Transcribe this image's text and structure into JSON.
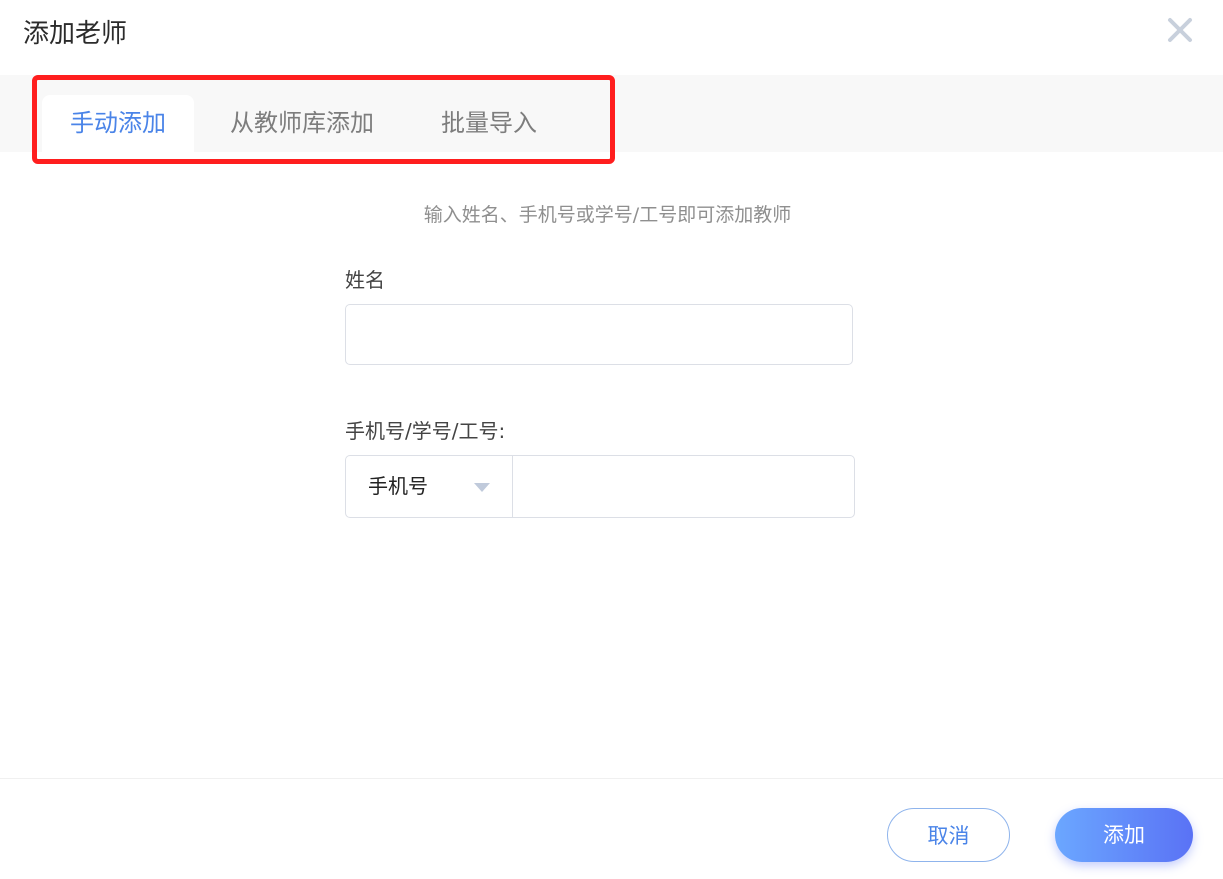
{
  "dialog": {
    "title": "添加老师",
    "close_icon": "close-icon"
  },
  "tabs": [
    {
      "label": "手动添加",
      "active": true
    },
    {
      "label": "从教师库添加",
      "active": false
    },
    {
      "label": "批量导入",
      "active": false
    }
  ],
  "form": {
    "hint": "输入姓名、手机号或学号/工号即可添加教师",
    "name_label": "姓名",
    "name_value": "",
    "id_label": "手机号/学号/工号:",
    "id_type_selected": "手机号",
    "id_value": ""
  },
  "footer": {
    "cancel_label": "取消",
    "add_label": "添加"
  },
  "colors": {
    "accent": "#4a84e8",
    "highlight": "#ff1e1e",
    "button_gradient_start": "#6ba7ff",
    "button_gradient_end": "#5a72f5"
  }
}
